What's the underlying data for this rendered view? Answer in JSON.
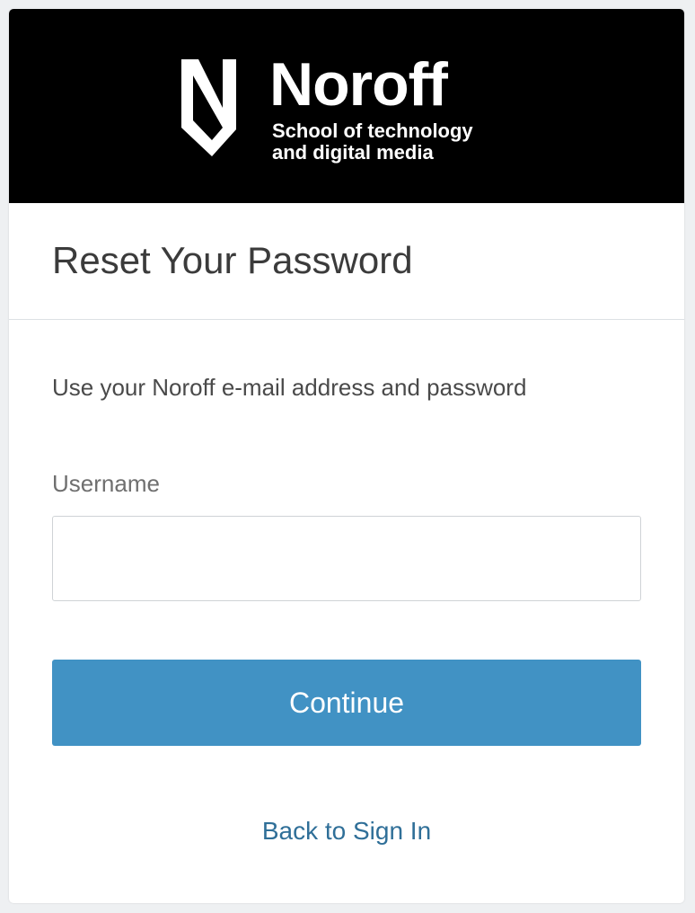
{
  "brand": {
    "name": "Noroff",
    "tagline_line1": "School of technology",
    "tagline_line2": "and digital media",
    "logo_icon": "noroff-n-shield-icon",
    "banner_color": "#000000"
  },
  "page": {
    "title": "Reset Your Password",
    "instructions": "Use your Noroff e-mail address and password"
  },
  "form": {
    "username_label": "Username",
    "username_value": "",
    "username_placeholder": "",
    "continue_label": "Continue",
    "continue_color": "#4192c4"
  },
  "links": {
    "back_to_sign_in": "Back to Sign In",
    "link_color": "#2f6f98"
  }
}
